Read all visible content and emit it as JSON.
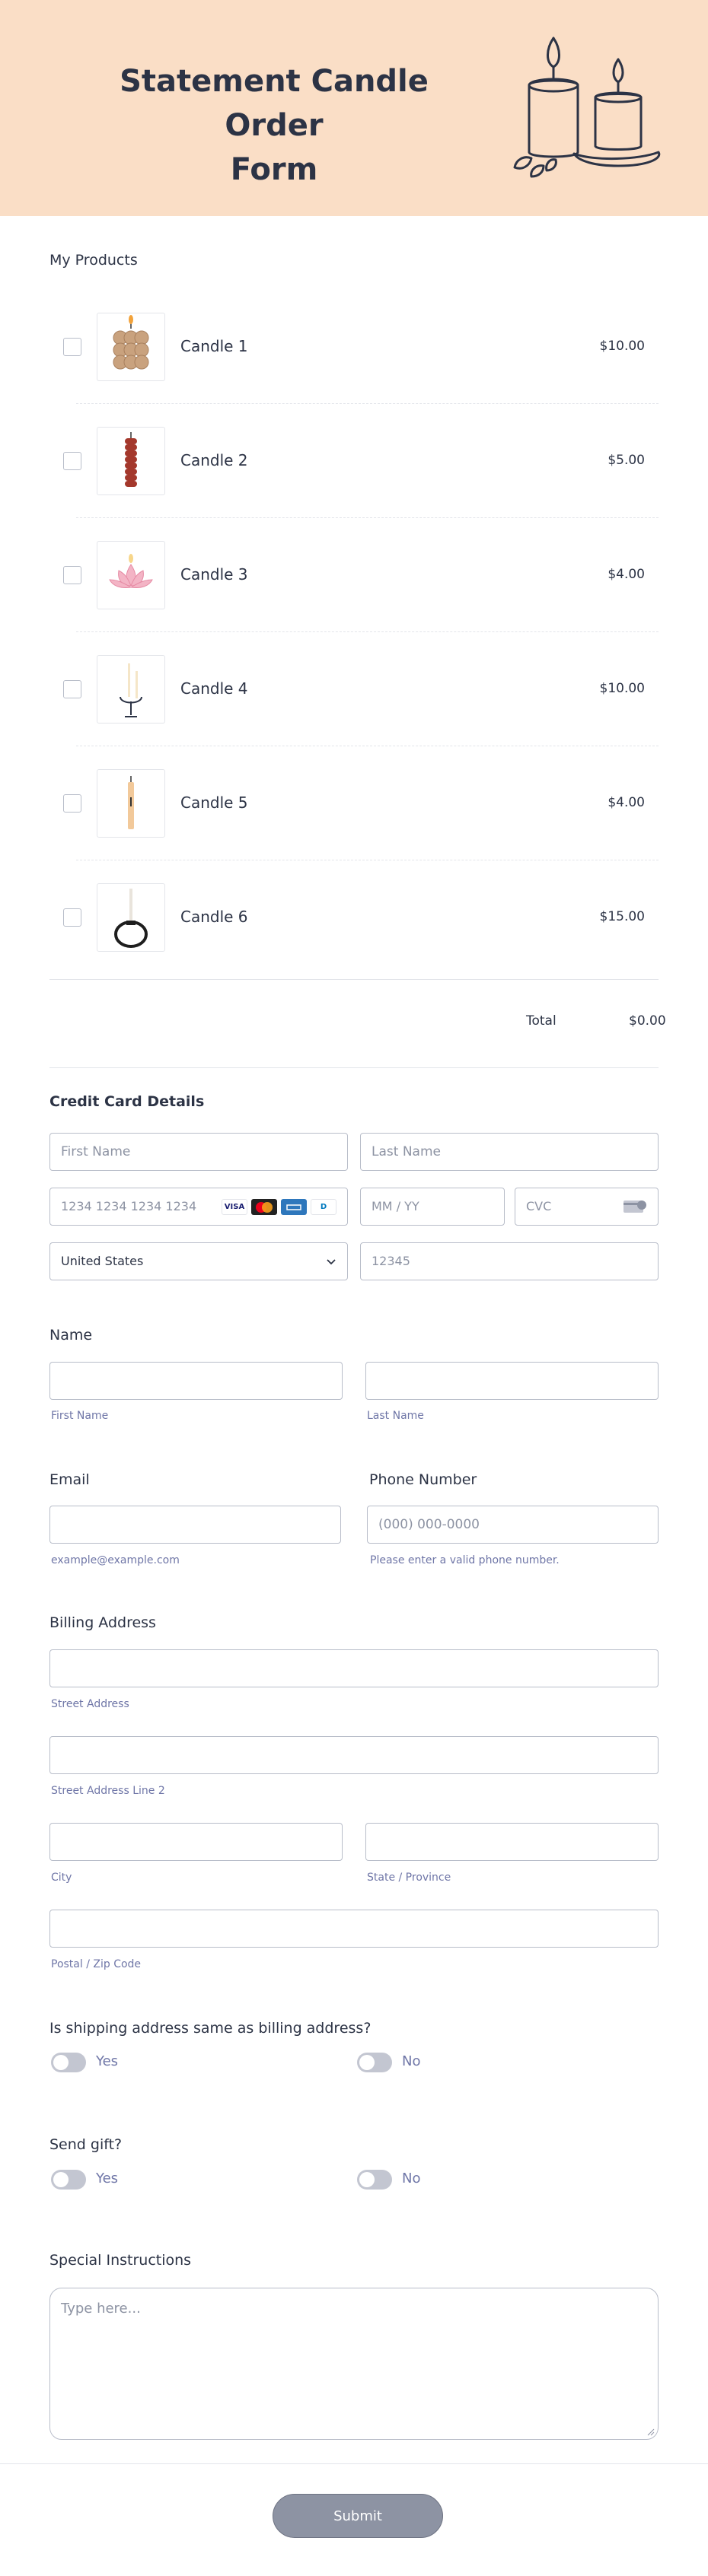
{
  "header": {
    "title_line1": "Statement Candle Order",
    "title_line2": "Form"
  },
  "products": {
    "heading": "My Products",
    "items": [
      {
        "name": "Candle 1",
        "price": "$10.00",
        "icon": "candle-bubble-icon"
      },
      {
        "name": "Candle 2",
        "price": "$5.00",
        "icon": "candle-pillar-icon"
      },
      {
        "name": "Candle 3",
        "price": "$4.00",
        "icon": "candle-lotus-icon"
      },
      {
        "name": "Candle 4",
        "price": "$10.00",
        "icon": "candle-holder-icon"
      },
      {
        "name": "Candle 5",
        "price": "$4.00",
        "icon": "candle-taper-icon"
      },
      {
        "name": "Candle 6",
        "price": "$15.00",
        "icon": "candle-ring-icon"
      }
    ],
    "total_label": "Total",
    "total_value": "$0.00"
  },
  "card": {
    "heading": "Credit Card Details",
    "first_name_placeholder": "First Name",
    "last_name_placeholder": "Last Name",
    "number_placeholder": "1234 1234 1234 1234",
    "expiry_placeholder": "MM / YY",
    "cvc_placeholder": "CVC",
    "country_value": "United States",
    "zip_value": "12345",
    "brands": [
      "VISA",
      "MC",
      "AMEX",
      "D"
    ]
  },
  "name": {
    "label": "Name",
    "first_sublabel": "First Name",
    "last_sublabel": "Last Name"
  },
  "email": {
    "label": "Email",
    "sublabel": "example@example.com"
  },
  "phone": {
    "label": "Phone Number",
    "placeholder": "(000) 000-0000",
    "sublabel": "Please enter a valid phone number."
  },
  "billing": {
    "label": "Billing Address",
    "street": "Street Address",
    "street2": "Street Address Line 2",
    "city": "City",
    "state": "State / Province",
    "zip": "Postal / Zip Code"
  },
  "shipping_same": {
    "question": "Is shipping address same as billing address?",
    "yes": "Yes",
    "no": "No"
  },
  "send_gift": {
    "question": "Send gift?",
    "yes": "Yes",
    "no": "No"
  },
  "instructions": {
    "label": "Special Instructions",
    "placeholder": "Type here..."
  },
  "submit_label": "Submit",
  "colors": {
    "header_bg": "#fadec6",
    "toggle_off": "#c3c6d1",
    "submit_bg": "#8d93a3"
  }
}
